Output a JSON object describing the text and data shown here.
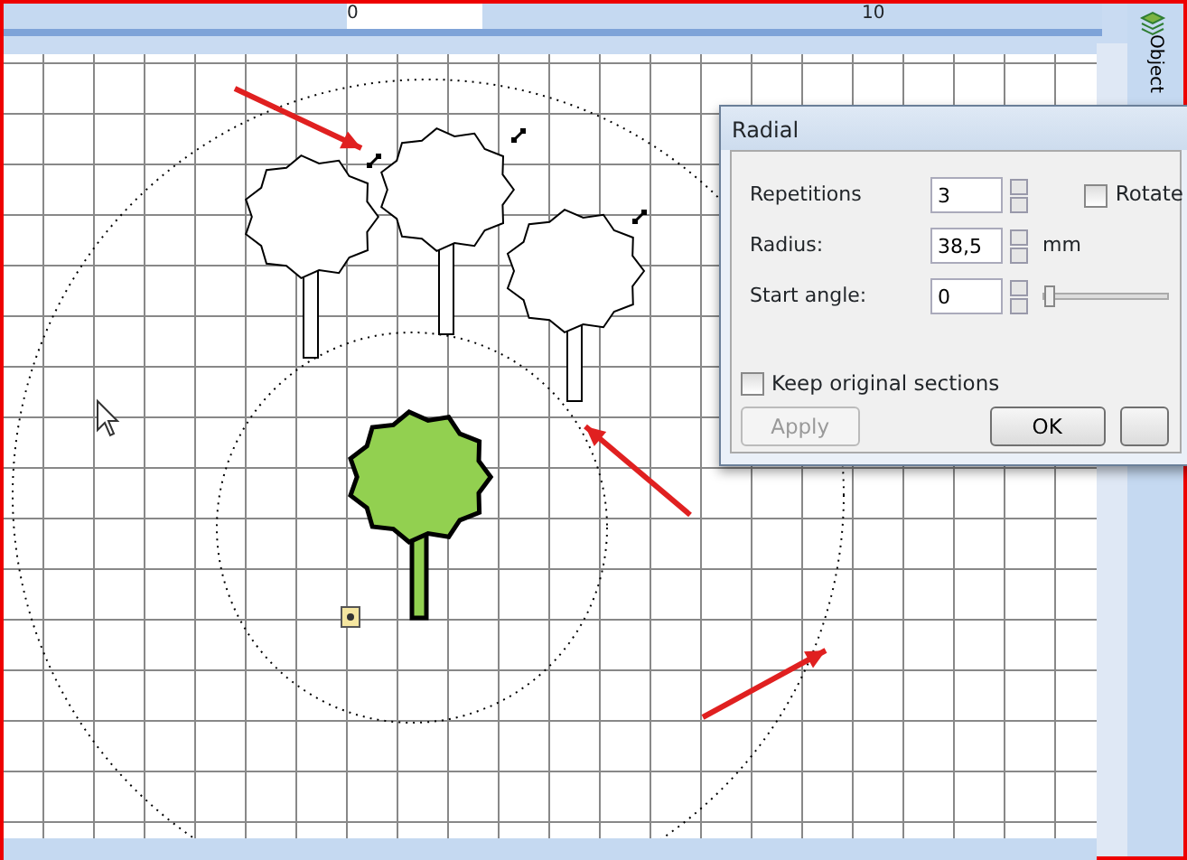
{
  "ruler": {
    "labels": [
      "0",
      "10"
    ]
  },
  "side_panel": {
    "tab_label": "Object"
  },
  "dialog": {
    "title": "Radial",
    "fields": [
      {
        "label": "Repetitions",
        "value": "3"
      },
      {
        "label": "Radius:",
        "value": "38,5",
        "unit": "mm"
      },
      {
        "label": "Start angle:",
        "value": "0"
      }
    ],
    "rotate": {
      "label": "Rotate",
      "checked": false
    },
    "start_angle_slider": {
      "level": 0
    },
    "keep_original": {
      "label": "Keep original sections",
      "checked": false
    },
    "buttons": [
      {
        "label": "Apply",
        "disabled": true
      },
      {
        "label": "OK",
        "disabled": false
      }
    ]
  }
}
